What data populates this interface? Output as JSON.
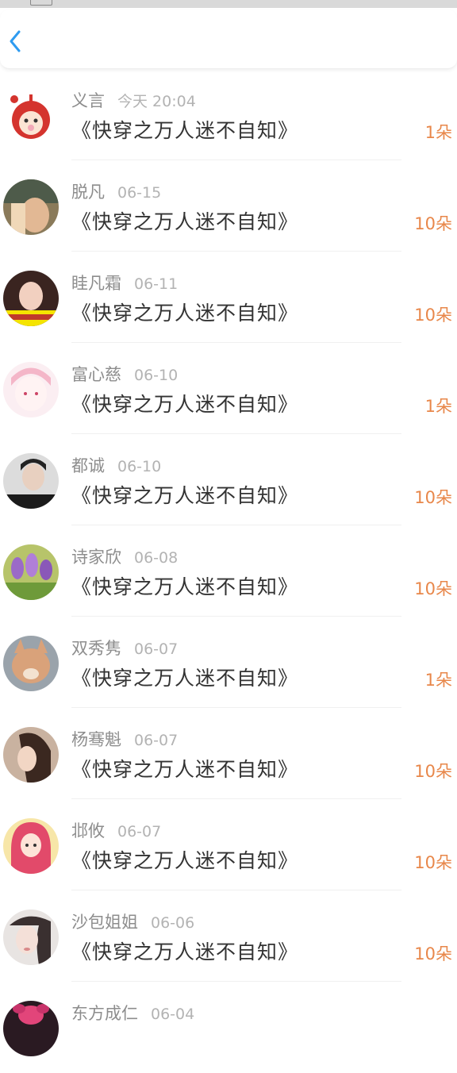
{
  "nav": {
    "back_icon": "chevron-left-icon",
    "accent_color": "#2e9bf0"
  },
  "colors": {
    "count_orange": "#e8874a",
    "name_gray": "#8d8d8d",
    "date_gray": "#b3b3b3",
    "title_dark": "#333333"
  },
  "list": [
    {
      "name": "义言",
      "date": "今天 20:04",
      "title": "《快穿之万人迷不自知》",
      "count": "1朵"
    },
    {
      "name": "脱凡",
      "date": "06-15",
      "title": "《快穿之万人迷不自知》",
      "count": "10朵"
    },
    {
      "name": "眭凡霜",
      "date": "06-11",
      "title": "《快穿之万人迷不自知》",
      "count": "10朵"
    },
    {
      "name": "富心慈",
      "date": "06-10",
      "title": "《快穿之万人迷不自知》",
      "count": "1朵"
    },
    {
      "name": "都诚",
      "date": "06-10",
      "title": "《快穿之万人迷不自知》",
      "count": "10朵"
    },
    {
      "name": "诗家欣",
      "date": "06-08",
      "title": "《快穿之万人迷不自知》",
      "count": "10朵"
    },
    {
      "name": "双秀隽",
      "date": "06-07",
      "title": "《快穿之万人迷不自知》",
      "count": "1朵"
    },
    {
      "name": "杨骞魁",
      "date": "06-07",
      "title": "《快穿之万人迷不自知》",
      "count": "10朵"
    },
    {
      "name": "邶攸",
      "date": "06-07",
      "title": "《快穿之万人迷不自知》",
      "count": "10朵"
    },
    {
      "name": "沙包姐姐",
      "date": "06-06",
      "title": "《快穿之万人迷不自知》",
      "count": "10朵"
    },
    {
      "name": "东方成仁",
      "date": "06-04",
      "title": "",
      "count": ""
    }
  ]
}
